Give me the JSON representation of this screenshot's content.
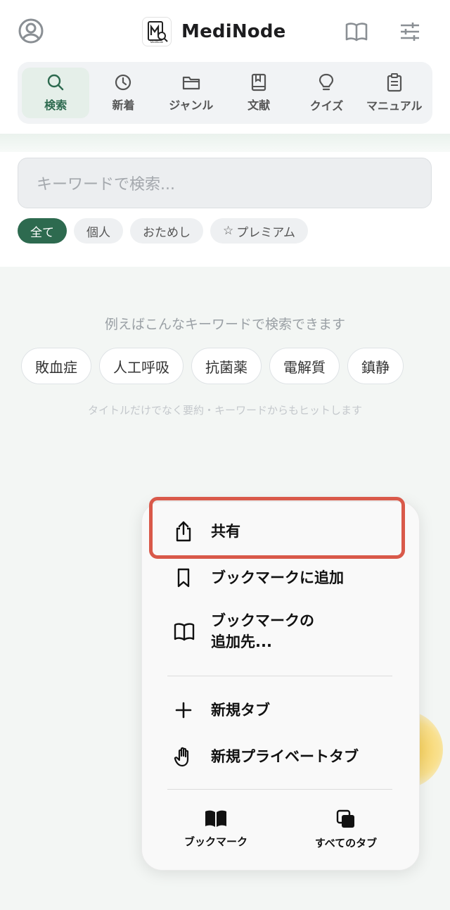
{
  "app": {
    "name": "MediNode",
    "logo_text": "MediNode"
  },
  "tabs": [
    {
      "label": "検索",
      "icon": "search-icon",
      "active": true
    },
    {
      "label": "新着",
      "icon": "clock-icon",
      "active": false
    },
    {
      "label": "ジャンル",
      "icon": "folder-icon",
      "active": false
    },
    {
      "label": "文献",
      "icon": "book-bookmark-icon",
      "active": false
    },
    {
      "label": "クイズ",
      "icon": "lightbulb-icon",
      "active": false
    },
    {
      "label": "マニュアル",
      "icon": "clipboard-icon",
      "active": false
    }
  ],
  "search": {
    "placeholder": "キーワードで検索..."
  },
  "filters": [
    {
      "label": "全て",
      "active": true
    },
    {
      "label": "個人",
      "active": false
    },
    {
      "label": "おためし",
      "active": false
    },
    {
      "label": "プレミアム",
      "active": false,
      "icon": "star-outline-icon"
    }
  ],
  "suggestions": {
    "hint": "例えばこんなキーワードで検索できます",
    "items": [
      "敗血症",
      "人工呼吸",
      "抗菌薬",
      "電解質",
      "鎮静"
    ],
    "subhint": "タイトルだけでなく要約・キーワードからもヒットします"
  },
  "menu": {
    "items": [
      {
        "label": "共有",
        "icon": "share-icon"
      },
      {
        "label": "ブックマークに追加",
        "icon": "bookmark-icon"
      },
      {
        "label_line1": "ブックマークの",
        "label_line2": "追加先...",
        "icon": "book-open-icon"
      },
      {
        "label": "新規タブ",
        "icon": "plus-icon"
      },
      {
        "label": "新規プライベートタブ",
        "icon": "hand-icon"
      }
    ],
    "bottom": [
      {
        "label": "ブックマーク",
        "icon": "book-filled-icon"
      },
      {
        "label": "すべてのタブ",
        "icon": "tabs-icon"
      }
    ]
  },
  "colors": {
    "accent": "#2d6a4f",
    "highlight": "#d9594a"
  }
}
